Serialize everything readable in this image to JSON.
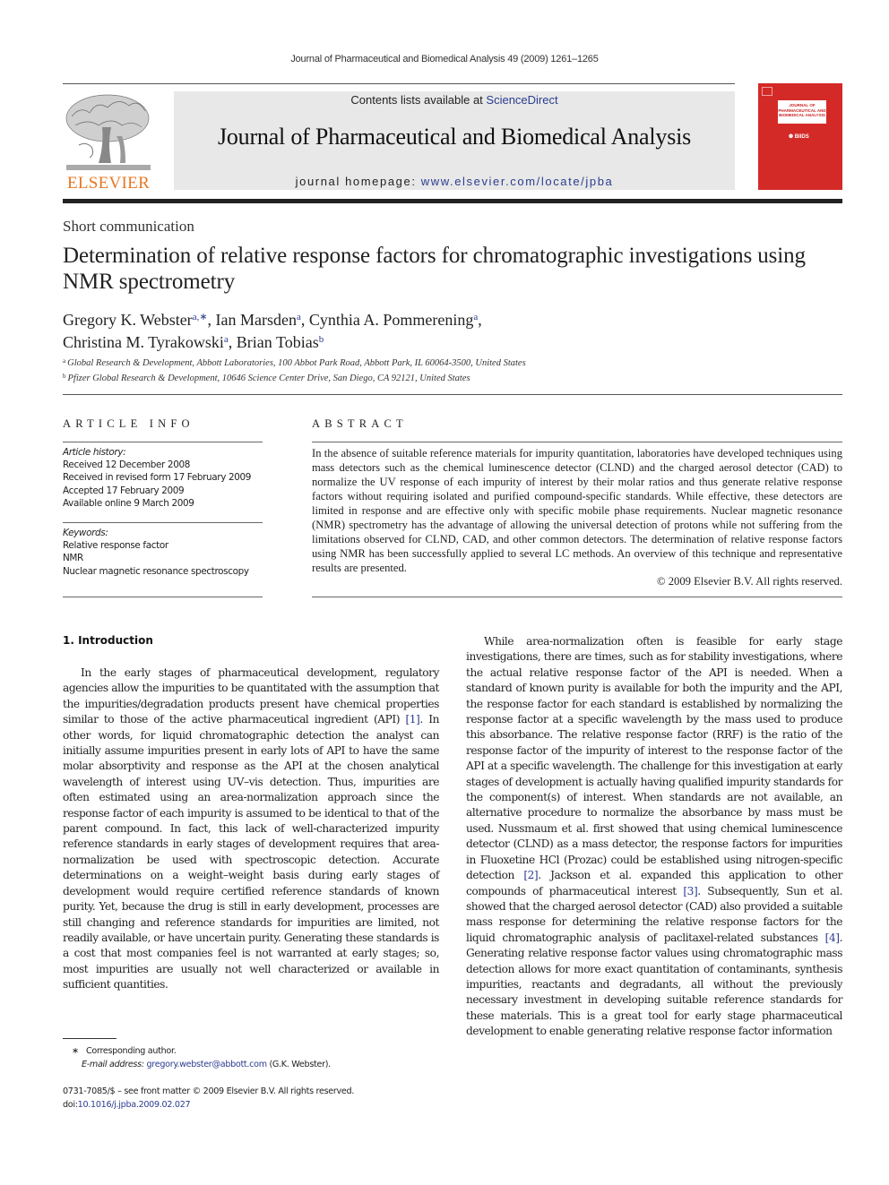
{
  "running_head": "Journal of Pharmaceutical and Biomedical Analysis 49 (2009) 1261–1265",
  "publisher": {
    "logo_text": "ELSEVIER",
    "logo_icon": "elsevier-tree-icon",
    "logo_color": "#e87722"
  },
  "masthead": {
    "contents_prefix": "Contents lists available at ",
    "contents_link": "ScienceDirect",
    "journal_title": "Journal of Pharmaceutical and Biomedical Analysis",
    "homepage_prefix": "journal homepage: ",
    "homepage_link": "www.elsevier.com/locate/jpba",
    "background": "#e8e8e8"
  },
  "cover": {
    "title_lines": "JOURNAL OF PHARMACEUTICAL AND BIOMEDICAL ANALYSIS",
    "emblem": "❁ BIIDS",
    "color": "#d42a27"
  },
  "article": {
    "type": "Short communication",
    "title": "Determination of relative response factors for chromatographic investigations using NMR spectrometry",
    "authors": [
      {
        "name": "Gregory K. Webster",
        "marks": "a,∗",
        "sep": ", "
      },
      {
        "name": "Ian Marsden",
        "marks": "a",
        "sep": ", "
      },
      {
        "name": "Cynthia A. Pommerening",
        "marks": "a",
        "sep": ","
      },
      {
        "name": "Christina M. Tyrakowski",
        "marks": "a",
        "sep": ", "
      },
      {
        "name": "Brian Tobias",
        "marks": "b",
        "sep": ""
      }
    ],
    "affiliations": [
      {
        "mark": "a",
        "text": "Global Research & Development, Abbott Laboratories, 100 Abbot Park Road, Abbott Park, IL 60064-3500, United States"
      },
      {
        "mark": "b",
        "text": "Pfizer Global Research & Development, 10646 Science Center Drive, San Diego, CA 92121, United States"
      }
    ]
  },
  "article_info": {
    "heading": "ARTICLE INFO",
    "history_label": "Article history:",
    "history": [
      "Received 12 December 2008",
      "Received in revised form 17 February 2009",
      "Accepted 17 February 2009",
      "Available online 9 March 2009"
    ],
    "keywords_label": "Keywords:",
    "keywords": [
      "Relative response factor",
      "NMR",
      "Nuclear magnetic resonance spectroscopy"
    ]
  },
  "abstract": {
    "heading": "ABSTRACT",
    "text": "In the absence of suitable reference materials for impurity quantitation, laboratories have developed techniques using mass detectors such as the chemical luminescence detector (CLND) and the charged aerosol detector (CAD) to normalize the UV response of each impurity of interest by their molar ratios and thus generate relative response factors without requiring isolated and purified compound-specific standards. While effective, these detectors are limited in response and are effective only with specific mobile phase requirements. Nuclear magnetic resonance (NMR) spectrometry has the advantage of allowing the universal detection of protons while not suffering from the limitations observed for CLND, CAD, and other common detectors. The determination of relative response factors using NMR has been successfully applied to several LC methods. An overview of this technique and representative results are presented.",
    "copyright": "© 2009 Elsevier B.V. All rights reserved."
  },
  "intro": {
    "heading": "1.  Introduction",
    "left_p1_a": "In the early stages of pharmaceutical development, regulatory agencies allow the impurities to be quantitated with the assumption that the impurities/degradation products present have chemical properties similar to those of the active pharmaceutical ingredient (API) ",
    "left_p1_ref1": "[1]",
    "left_p1_b": ". In other words, for liquid chromatographic detection the analyst can initially assume impurities present in early lots of API to have the same molar absorptivity and response as the API at the chosen analytical wavelength of interest using UV–vis detection. Thus, impurities are often estimated using an area-normalization approach since the response factor of each impurity is assumed to be identical to that of the parent compound. In fact, this lack of well-characterized impurity reference standards in early stages of development requires that area-normalization be used with spectroscopic detection. Accurate determinations on a weight–weight basis during early stages of development would require certified reference standards of known purity. Yet, because the drug is still in early development, processes are still changing and reference standards for impurities are limited, not readily available, or have uncertain purity. Generating these standards is a cost that most companies feel is not warranted at early stages; so, most impurities are usually not well characterized or available in sufficient quantities.",
    "right_a": "While area-normalization often is feasible for early stage investigations, there are times, such as for stability investigations, where the actual relative response factor of the API is needed. When a standard of known purity is available for both the impurity and the API, the response factor for each standard is established by normalizing the response factor at a specific wavelength by the mass used to produce this absorbance. The relative response factor (RRF) is the ratio of the response factor of the impurity of interest to the response factor of the API at a specific wavelength. The challenge for this investigation at early stages of development is actually having qualified impurity standards for the component(s) of interest. When standards are not available, an alternative procedure to normalize the absorbance by mass must be used. Nussmaum et al. first showed that using chemical luminescence detector (CLND) as a mass detector, the response factors for impurities in Fluoxetine HCl (Prozac) could be established using nitrogen-specific detection ",
    "right_ref2": "[2]",
    "right_b": ". Jackson et al. expanded this application to other compounds of pharmaceutical interest ",
    "right_ref3": "[3]",
    "right_c": ". Subsequently, Sun et al. showed that the charged aerosol detector (CAD) also provided a suitable mass response for determining the relative response factors for the liquid chromatographic analysis of paclitaxel-related substances ",
    "right_ref4": "[4]",
    "right_d": ". Generating relative response factor values using chromatographic mass detection allows for more exact quantitation of contaminants, synthesis impurities, reactants and degradants, all without the previously necessary investment in developing suitable reference standards for these materials. This is a great tool for early stage pharmaceutical development to enable generating relative response factor information"
  },
  "footnotes": {
    "mark": "∗",
    "corresponding": "Corresponding author.",
    "email_label": "E-mail address:",
    "email": "gregory.webster@abbott.com",
    "email_suffix": " (G.K. Webster)."
  },
  "front_matter": {
    "issn_line": "0731-7085/$ – see front matter © 2009 Elsevier B.V. All rights reserved.",
    "doi_prefix": "doi:",
    "doi": "10.1016/j.jpba.2009.02.027"
  },
  "colors": {
    "link": "#2b3d8f"
  }
}
